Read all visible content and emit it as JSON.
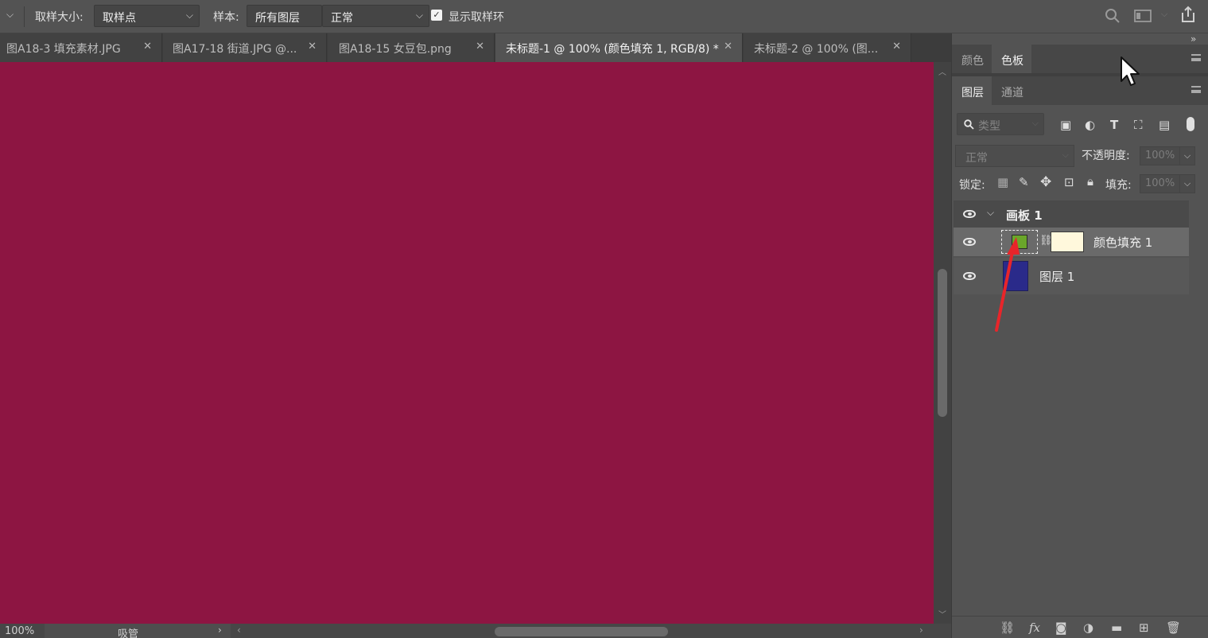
{
  "options_bar": {
    "sample_size_label": "取样大小:",
    "sample_size_value": "取样点",
    "sample_label": "样本:",
    "sample_value": "所有图层",
    "blend_value": "正常",
    "show_ring_label": "显示取样环",
    "show_ring_checked": true
  },
  "tabs": [
    {
      "label": "图A18-3 填充素材.JPG",
      "active": false
    },
    {
      "label": "图A17-18 街道.JPG @...",
      "active": false
    },
    {
      "label": "图A18-15 女豆包.png",
      "active": false
    },
    {
      "label": "未标题-1 @ 100% (颜色填充 1, RGB/8) *",
      "active": true
    },
    {
      "label": "未标题-2 @ 100% (图...",
      "active": false
    }
  ],
  "canvas": {
    "fill_color": "#8d1542"
  },
  "status": {
    "zoom": "100%",
    "tool": "吸管"
  },
  "color_panel": {
    "tabs": [
      "颜色",
      "色板"
    ],
    "active_tab": "色板"
  },
  "layers_panel": {
    "tabs": [
      "图层",
      "通道"
    ],
    "active_tab": "图层",
    "filter_placeholder": "类型",
    "blend_mode": "正常",
    "opacity_label": "不透明度:",
    "opacity_value": "100%",
    "lock_label": "锁定:",
    "fill_label": "填充:",
    "fill_value": "100%",
    "layers": [
      {
        "name": "画板 1",
        "type": "artboard"
      },
      {
        "name": "颜色填充 1",
        "type": "fill",
        "selected": true,
        "thumb_color": "#6aa62a",
        "mask_color": "#fff8dc"
      },
      {
        "name": "图层 1",
        "type": "pixel",
        "thumb_color": "#2a2a8a"
      }
    ]
  },
  "annotation": {
    "arrow_color": "#e8252a"
  }
}
